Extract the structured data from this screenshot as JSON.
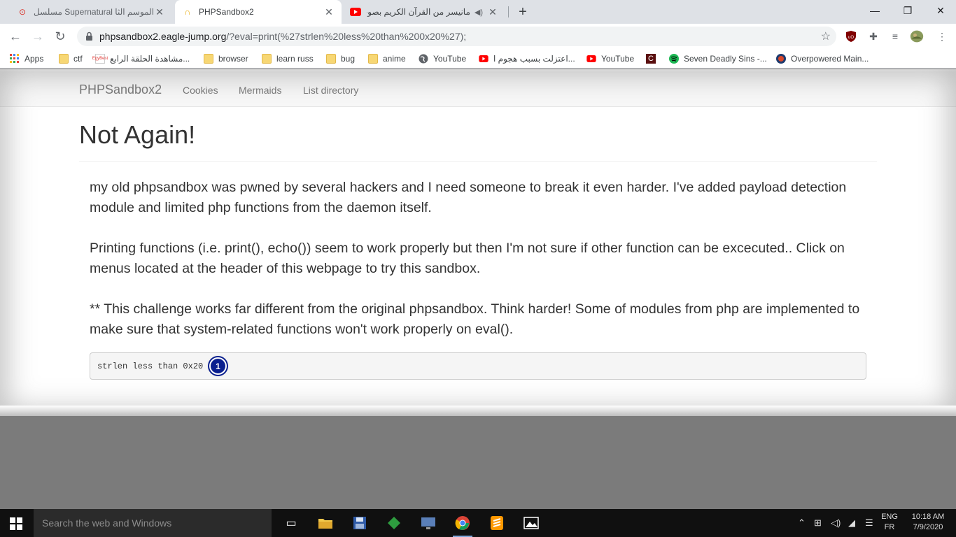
{
  "browser": {
    "tabs": [
      {
        "title": "مسلسل Supernatural الموسم الثا",
        "favicon": "pin-icon"
      },
      {
        "title": "PHPSandbox2",
        "favicon": "ctf-icon"
      },
      {
        "title": "مانيسر من القرآن الكريم بصوت",
        "favicon": "youtube-icon"
      }
    ],
    "new_tab": "+",
    "window_controls": {
      "minimize": "—",
      "maximize": "❐",
      "close": "✕"
    },
    "url_host": "phpsandbox2.eagle-jump.org",
    "url_rest": "/?eval=print(%27strlen%20less%20than%200x20%27);",
    "bookmarks": [
      {
        "label": "Apps",
        "icon": "apps-grid-icon"
      },
      {
        "label": "ctf",
        "icon": "folder-icon"
      },
      {
        "label": "مشاهدة الحلقة الرابع...",
        "icon": "site-icon"
      },
      {
        "label": "browser",
        "icon": "folder-icon"
      },
      {
        "label": "learn russ",
        "icon": "folder-icon"
      },
      {
        "label": "bug",
        "icon": "folder-icon"
      },
      {
        "label": "anime",
        "icon": "folder-icon"
      },
      {
        "label": "YouTube",
        "icon": "globe-icon"
      },
      {
        "label": "اعتزلت بسبب هجوم ا...",
        "icon": "youtube-icon"
      },
      {
        "label": "YouTube",
        "icon": "youtube-icon"
      },
      {
        "label": "",
        "icon": "c-icon"
      },
      {
        "label": "Seven Deadly Sins -...",
        "icon": "spotify-icon"
      },
      {
        "label": "Overpowered Main...",
        "icon": "game-icon"
      }
    ]
  },
  "site": {
    "brand": "PHPSandbox2",
    "nav": [
      "Cookies",
      "Mermaids",
      "List directory"
    ],
    "title": "Not Again!",
    "paragraphs": [
      "my old phpsandbox was pwned by several hackers and I need someone to break it even harder. I've added payload detection module and limited php functions from the daemon itself.",
      "Printing functions (i.e. print(), echo()) seem to work properly but then I'm not sure if other function can be excecuted.. Click on menus located at the header of this webpage to try this sandbox.",
      "** This challenge works far different from the original phpsandbox. Think harder! Some of modules from php are implemented to make sure that system-related functions won't work properly on eval()."
    ],
    "output": "strlen less than 0x20",
    "badge": "1"
  },
  "taskbar": {
    "search_placeholder": "Search the web and Windows",
    "lang_top": "ENG",
    "lang_bottom": "FR",
    "time": "10:18 AM",
    "date": "7/9/2020"
  }
}
